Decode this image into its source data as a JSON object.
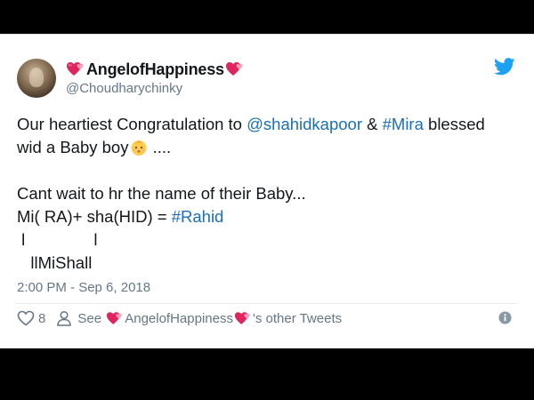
{
  "user": {
    "display_name": "AngelofHappiness",
    "handle": "@Choudharychinky"
  },
  "tweet": {
    "line1": {
      "part1": "Our heartiest Congratulation to ",
      "mention": "@shahidkapoor",
      "part2": " & ",
      "hashtag": "#Mira",
      "part3": " blessed"
    },
    "line2": {
      "text": "wid a Baby boy",
      "after_emoji": " ...."
    },
    "line4": "Cant wait to hr the name of their Baby...",
    "line5": {
      "text": "Mi( RA)+ sha(HID) = ",
      "hashtag": "#Rahid"
    },
    "line6": " l               l",
    "line7": "   llMiShall"
  },
  "timestamp": "2:00 PM - Sep 6, 2018",
  "actions": {
    "like_count": "8",
    "see_label": "See",
    "see_user": "AngelofHappiness",
    "see_suffix": "'s other Tweets"
  },
  "icons": {
    "brand_bird": "twitter-bird-icon",
    "heart_emoji": "revolving-hearts-icon",
    "baby_emoji": "baby-face-icon",
    "like": "heart-outline-icon",
    "person": "person-icon",
    "info": "info-icon"
  },
  "colors": {
    "link": "#1b6fb5",
    "twitter_blue": "#1da1f2",
    "text": "#14171a",
    "muted": "#657786",
    "heart_red": "#e0245e",
    "background": "#000000"
  }
}
